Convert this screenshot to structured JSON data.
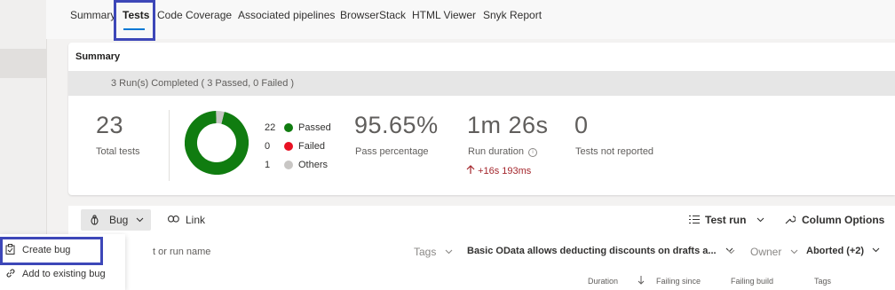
{
  "tabs": [
    {
      "label": "Summary"
    },
    {
      "label": "Tests"
    },
    {
      "label": "Code Coverage"
    },
    {
      "label": "Associated pipelines"
    },
    {
      "label": "BrowserStack"
    },
    {
      "label": "HTML Viewer"
    },
    {
      "label": "Snyk Report"
    }
  ],
  "summary": {
    "title": "Summary",
    "run_status": "3 Run(s) Completed ( 3 Passed, 0 Failed )",
    "total_tests_value": "23",
    "total_tests_label": "Total tests",
    "legend": [
      {
        "count": "22",
        "label": "Passed",
        "color": "#107c10"
      },
      {
        "count": "0",
        "label": "Failed",
        "color": "#e81123"
      },
      {
        "count": "1",
        "label": "Others",
        "color": "#c8c6c4"
      }
    ],
    "pass_percentage_value": "95.65%",
    "pass_percentage_label": "Pass percentage",
    "run_duration_value": "1m 26s",
    "run_duration_label": "Run duration",
    "run_duration_delta": "+16s 193ms",
    "not_reported_value": "0",
    "not_reported_label": "Tests not reported"
  },
  "chart_data": {
    "type": "pie",
    "categories": [
      "Passed",
      "Failed",
      "Others"
    ],
    "values": [
      22,
      0,
      1
    ]
  },
  "toolbar": {
    "bug_label": "Bug",
    "link_label": "Link",
    "test_run_label": "Test run",
    "column_options_label": "Column Options"
  },
  "filters": {
    "search_placeholder": "t or run name",
    "tags_label": "Tags",
    "test_filter_value": "Basic OData allows deducting discounts on drafts a...",
    "owner_label": "Owner",
    "outcome_value": "Aborted (+2)"
  },
  "columns": {
    "duration": "Duration",
    "failing_since": "Failing since",
    "failing_build": "Failing build",
    "tags": "Tags"
  },
  "bug_menu": {
    "items": [
      {
        "label": "Create bug"
      },
      {
        "label": "Add to existing bug"
      }
    ]
  },
  "colors": {
    "accent": "#0078d4",
    "highlight": "#3d47b8",
    "passed": "#107c10",
    "failed": "#e81123",
    "others": "#c8c6c4",
    "delta": "#a4262c"
  }
}
